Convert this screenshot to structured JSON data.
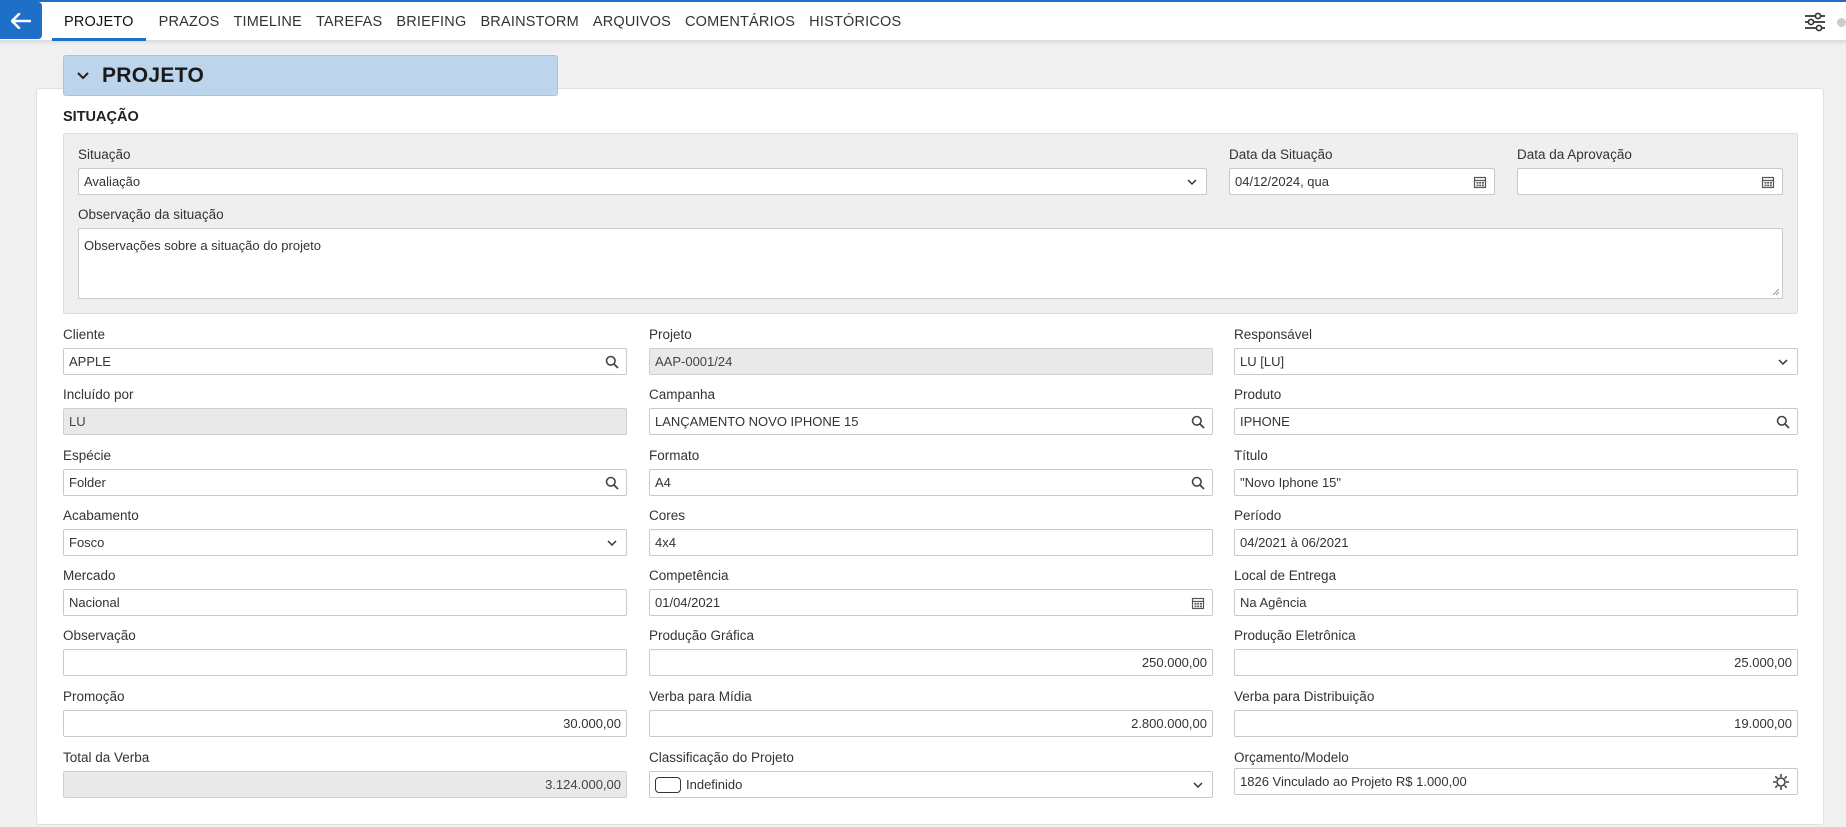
{
  "tabs": [
    "PROJETO",
    "PRAZOS",
    "TIMELINE",
    "TAREFAS",
    "BRIEFING",
    "BRAINSTORM",
    "ARQUIVOS",
    "COMENTÁRIOS",
    "HISTÓRICOS"
  ],
  "colors": {
    "accent": "#1e6fc8",
    "section_header_bg": "#bcd5ec",
    "readonly_bg": "#e9e9e9"
  },
  "section": {
    "title": "PROJETO"
  },
  "situacao": {
    "heading": "SITUAÇÃO",
    "situacao_label": "Situação",
    "situacao_value": "Avaliação",
    "data_situacao_label": "Data da Situação",
    "data_situacao_value": "04/12/2024, qua",
    "data_aprovacao_label": "Data da Aprovação",
    "data_aprovacao_value": "",
    "observacao_label": "Observação da situação",
    "observacao_value": "Observações sobre a situação do projeto"
  },
  "fields": {
    "cliente": {
      "label": "Cliente",
      "value": "APPLE"
    },
    "projeto": {
      "label": "Projeto",
      "value": "AAP-0001/24"
    },
    "responsavel": {
      "label": "Responsável",
      "value": "LU [LU]"
    },
    "incluido_por": {
      "label": "Incluído por",
      "value": "LU"
    },
    "campanha": {
      "label": "Campanha",
      "value": "LANÇAMENTO NOVO IPHONE 15"
    },
    "produto": {
      "label": "Produto",
      "value": "IPHONE"
    },
    "especie": {
      "label": "Espécie",
      "value": "Folder"
    },
    "formato": {
      "label": "Formato",
      "value": "A4"
    },
    "titulo": {
      "label": "Título",
      "value": "\"Novo Iphone 15\""
    },
    "acabamento": {
      "label": "Acabamento",
      "value": "Fosco"
    },
    "cores": {
      "label": "Cores",
      "value": "4x4"
    },
    "periodo": {
      "label": "Período",
      "value": "04/2021 à 06/2021"
    },
    "mercado": {
      "label": "Mercado",
      "value": "Nacional"
    },
    "competencia": {
      "label": "Competência",
      "value": "01/04/2021"
    },
    "local_entrega": {
      "label": "Local de Entrega",
      "value": "Na Agência"
    },
    "observacao": {
      "label": "Observação",
      "value": ""
    },
    "producao_grafica": {
      "label": "Produção Gráfica",
      "value": "250.000,00"
    },
    "producao_eletronica": {
      "label": "Produção Eletrônica",
      "value": "25.000,00"
    },
    "promocao": {
      "label": "Promoção",
      "value": "30.000,00"
    },
    "verba_midia": {
      "label": "Verba para Mídia",
      "value": "2.800.000,00"
    },
    "verba_distribuicao": {
      "label": "Verba para Distribuição",
      "value": "19.000,00"
    },
    "total_verba": {
      "label": "Total da Verba",
      "value": "3.124.000,00"
    },
    "classificacao": {
      "label": "Classificação do Projeto",
      "value": "Indefinido"
    },
    "orcamento": {
      "label": "Orçamento/Modelo",
      "value": "1826 Vinculado ao Projeto R$ 1.000,00"
    }
  }
}
